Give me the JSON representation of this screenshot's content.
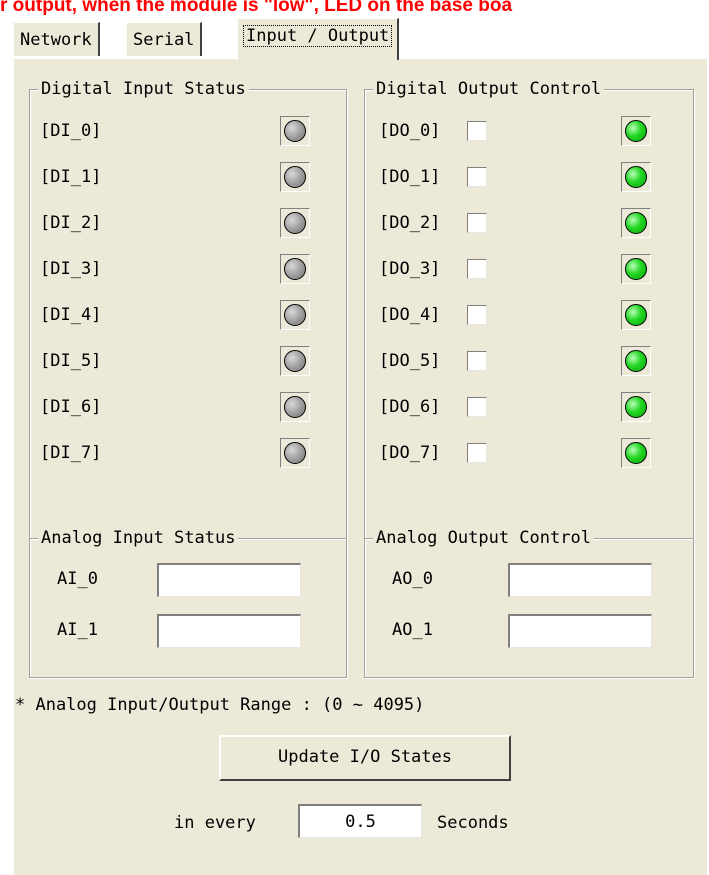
{
  "banner": "r output, when the module is \"low\", LED on the base boa",
  "tabs": [
    {
      "label": "Network"
    },
    {
      "label": "Serial"
    },
    {
      "label": "Input / Output"
    }
  ],
  "digital_input": {
    "title": "Digital Input Status",
    "items": [
      {
        "label": "[DI_0]",
        "state": "off"
      },
      {
        "label": "[DI_1]",
        "state": "off"
      },
      {
        "label": "[DI_2]",
        "state": "off"
      },
      {
        "label": "[DI_3]",
        "state": "off"
      },
      {
        "label": "[DI_4]",
        "state": "off"
      },
      {
        "label": "[DI_5]",
        "state": "off"
      },
      {
        "label": "[DI_6]",
        "state": "off"
      },
      {
        "label": "[DI_7]",
        "state": "off"
      }
    ]
  },
  "digital_output": {
    "title": "Digital Output Control",
    "items": [
      {
        "label": "[DO_0]",
        "checked": false,
        "state": "on"
      },
      {
        "label": "[DO_1]",
        "checked": false,
        "state": "on"
      },
      {
        "label": "[DO_2]",
        "checked": false,
        "state": "on"
      },
      {
        "label": "[DO_3]",
        "checked": false,
        "state": "on"
      },
      {
        "label": "[DO_4]",
        "checked": false,
        "state": "on"
      },
      {
        "label": "[DO_5]",
        "checked": false,
        "state": "on"
      },
      {
        "label": "[DO_6]",
        "checked": false,
        "state": "on"
      },
      {
        "label": "[DO_7]",
        "checked": false,
        "state": "on"
      }
    ]
  },
  "analog_input": {
    "title": "Analog Input Status",
    "items": [
      {
        "label": "AI_0",
        "value": ""
      },
      {
        "label": "AI_1",
        "value": ""
      }
    ]
  },
  "analog_output": {
    "title": "Analog Output Control",
    "items": [
      {
        "label": "AO_0",
        "value": ""
      },
      {
        "label": "AO_1",
        "value": ""
      }
    ]
  },
  "range_note": "* Analog Input/Output Range : (0 ~ 4095)",
  "update_button": "Update I/O States",
  "interval": {
    "prefix": "in every",
    "value": "0.5",
    "suffix": "Seconds"
  },
  "colors": {
    "led_on": "#22d622",
    "led_off": "#9a9a9a",
    "banner": "#ff0000",
    "panel": "#ece9d8"
  }
}
